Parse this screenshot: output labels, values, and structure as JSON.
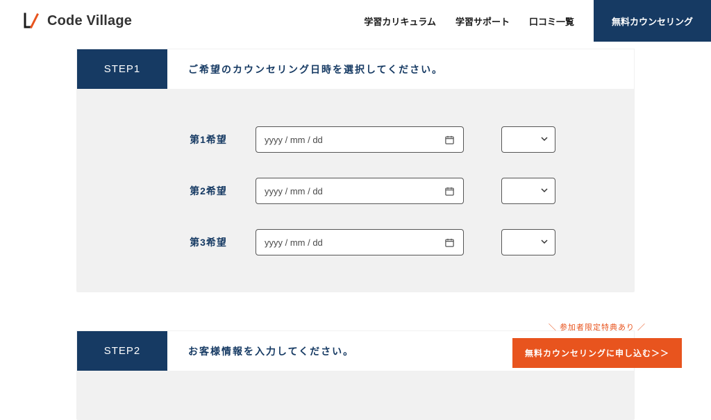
{
  "header": {
    "brand": "Code Village",
    "nav": {
      "curriculum": "学習カリキュラム",
      "support": "学習サポート",
      "reviews": "口コミ一覧",
      "cta": "無料カウンセリング"
    }
  },
  "step1": {
    "badge": "STEP1",
    "title": "ご希望のカウンセリング日時を選択してください。",
    "rows": [
      {
        "label": "第1希望",
        "placeholder": "yyyy / mm / dd"
      },
      {
        "label": "第2希望",
        "placeholder": "yyyy / mm / dd"
      },
      {
        "label": "第3希望",
        "placeholder": "yyyy / mm / dd"
      }
    ]
  },
  "step2": {
    "badge": "STEP2",
    "title": "お客様情報を入力してください。"
  },
  "float": {
    "tag": "＼ 参加者限定特典あり ／",
    "label": "無料カウンセリングに申し込む＞＞"
  }
}
